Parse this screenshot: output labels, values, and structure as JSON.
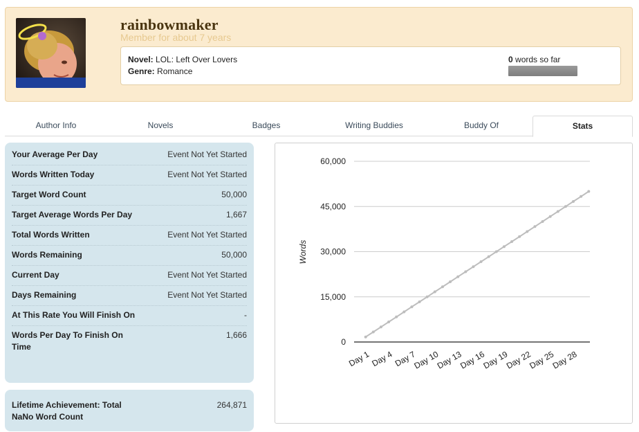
{
  "profile": {
    "username": "rainbowmaker",
    "member_since": "Member for about 7 years",
    "novel_label": "Novel:",
    "novel_title": "LOL: Left Over Lovers",
    "genre_label": "Genre:",
    "genre": "Romance",
    "words_count": "0",
    "words_suffix": "words so far",
    "progress": 0
  },
  "tabs": [
    {
      "label": "Author Info",
      "active": false
    },
    {
      "label": "Novels",
      "active": false
    },
    {
      "label": "Badges",
      "active": false
    },
    {
      "label": "Writing Buddies",
      "active": false
    },
    {
      "label": "Buddy Of",
      "active": false
    },
    {
      "label": "Stats",
      "active": true
    }
  ],
  "stats": [
    {
      "label": "Your Average Per Day",
      "value": "Event Not Yet Started"
    },
    {
      "label": "Words Written Today",
      "value": "Event Not Yet Started"
    },
    {
      "label": "Target Word Count",
      "value": "50,000"
    },
    {
      "label": "Target Average Words Per Day",
      "value": "1,667"
    },
    {
      "label": "Total Words Written",
      "value": "Event Not Yet Started"
    },
    {
      "label": "Words Remaining",
      "value": "50,000"
    },
    {
      "label": "Current Day",
      "value": "Event Not Yet Started"
    },
    {
      "label": "Days Remaining",
      "value": "Event Not Yet Started"
    },
    {
      "label": "At This Rate You Will Finish On",
      "value": "-"
    },
    {
      "label": "Words Per Day To Finish On Time",
      "value": "1,666"
    }
  ],
  "lifetime": {
    "label": "Lifetime Achievement: Total NaNo Word Count",
    "value": "264,871"
  },
  "chart_data": {
    "type": "line",
    "ylabel": "Words",
    "xlabel": "",
    "ylim": [
      0,
      60000
    ],
    "yticks": [
      "0",
      "15,000",
      "30,000",
      "45,000",
      "60,000"
    ],
    "ytick_values": [
      0,
      15000,
      30000,
      45000,
      60000
    ],
    "xtick_labels": [
      "Day 1",
      "Day 4",
      "Day 7",
      "Day 10",
      "Day 13",
      "Day 16",
      "Day 19",
      "Day 22",
      "Day 25",
      "Day 28"
    ],
    "xtick_days": [
      1,
      4,
      7,
      10,
      13,
      16,
      19,
      22,
      25,
      28
    ],
    "grid": true,
    "series": [
      {
        "color": "#bdbdbd",
        "x": [
          1,
          2,
          3,
          4,
          5,
          6,
          7,
          8,
          9,
          10,
          11,
          12,
          13,
          14,
          15,
          16,
          17,
          18,
          19,
          20,
          21,
          22,
          23,
          24,
          25,
          26,
          27,
          28,
          29,
          30
        ],
        "values": [
          1667,
          3333,
          5000,
          6667,
          8333,
          10000,
          11667,
          13333,
          15000,
          16667,
          18333,
          20000,
          21667,
          23333,
          25000,
          26667,
          28333,
          30000,
          31667,
          33333,
          35000,
          36667,
          38333,
          40000,
          41667,
          43333,
          45000,
          46667,
          48333,
          50000
        ]
      }
    ]
  }
}
